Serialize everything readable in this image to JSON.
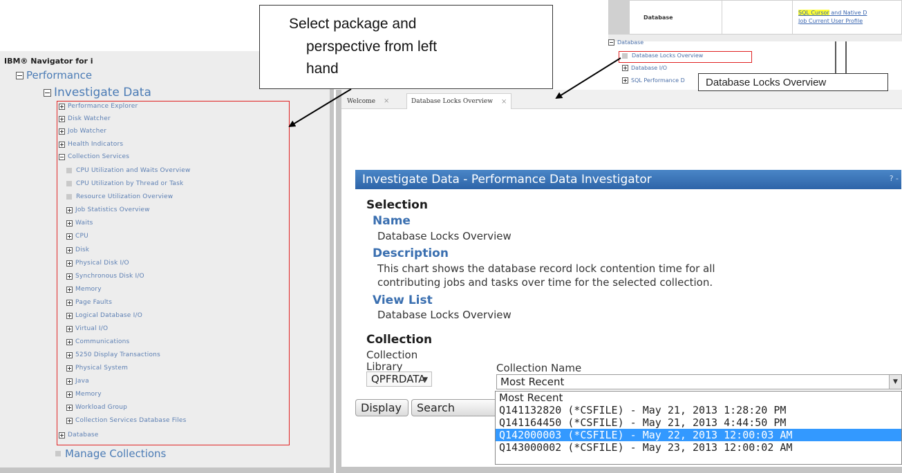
{
  "callout": {
    "line1": "Select package and",
    "line2": "perspective from left",
    "line3": "hand"
  },
  "navigator": {
    "header": "IBM® Navigator for i",
    "performance": "Performance",
    "investigate_data": "Investigate Data",
    "items": [
      "Performance Explorer",
      "Disk Watcher",
      "Job Watcher",
      "Health Indicators",
      "Collection Services"
    ],
    "collection_services_children": [
      "CPU Utilization and Waits Overview",
      "CPU Utilization by Thread or Task",
      "Resource Utilization Overview",
      "Job Statistics Overview",
      "Waits",
      "CPU",
      "Disk",
      "Physical Disk I/O",
      "Synchronous Disk I/O",
      "Memory",
      "Page Faults",
      "Logical Database I/O",
      "Virtual I/O",
      "Communications",
      "5250 Display Transactions",
      "Physical System",
      "Java",
      "Memory",
      "Workload Group",
      "Collection Services Database Files"
    ],
    "database": "Database",
    "manage_collections": "Manage Collections"
  },
  "inset": {
    "table_label": "Database",
    "sql_link_highlight": "SQL Cursor",
    "sql_link_rest": " and Native D",
    "sql_link_line2": "Job Current User Profile",
    "tree_database": "Database",
    "tree_locks": "Database Locks Overview",
    "tree_io": "Database I/O",
    "tree_sql_perf": "SQL Performance D",
    "tooltip": "Database Locks Overview"
  },
  "tabs": [
    {
      "label": "Welcome",
      "close": "×"
    },
    {
      "label": "Database Locks Overview",
      "close": "×"
    }
  ],
  "pdi": {
    "title": "Investigate Data - Performance Data Investigator",
    "help": "? -",
    "selection_heading": "Selection",
    "name_label": "Name",
    "name_value": "Database Locks Overview",
    "description_label": "Description",
    "description_line1": "This chart shows the database record lock contention time for all",
    "description_line2": "contributing jobs and tasks over time for the selected collection.",
    "view_list_label": "View List",
    "view_list_value": "Database Locks Overview",
    "collection_heading": "Collection",
    "collection_library_label1": "Collection",
    "collection_library_label2": "Library",
    "library_value": "QPFRDATA",
    "collection_name_label": "Collection Name",
    "collection_name_value": "Most Recent",
    "options": [
      "Most Recent",
      "Q141132820 (*CSFILE) - May 21, 2013 1:28:20 PM",
      "Q141164450 (*CSFILE) - May 21, 2013 4:44:50 PM",
      "Q142000003 (*CSFILE) - May 22, 2013 12:00:03 AM",
      "Q143000002 (*CSFILE) - May 23, 2013 12:00:02 AM"
    ],
    "selected_option_index": 3,
    "display_button": "Display",
    "search_button": "Search"
  },
  "colors": {
    "title_bar": "#2d64a8",
    "link_blue": "#3a6fb0",
    "highlight_red": "#e02020",
    "selected_option": "#3399ff"
  }
}
